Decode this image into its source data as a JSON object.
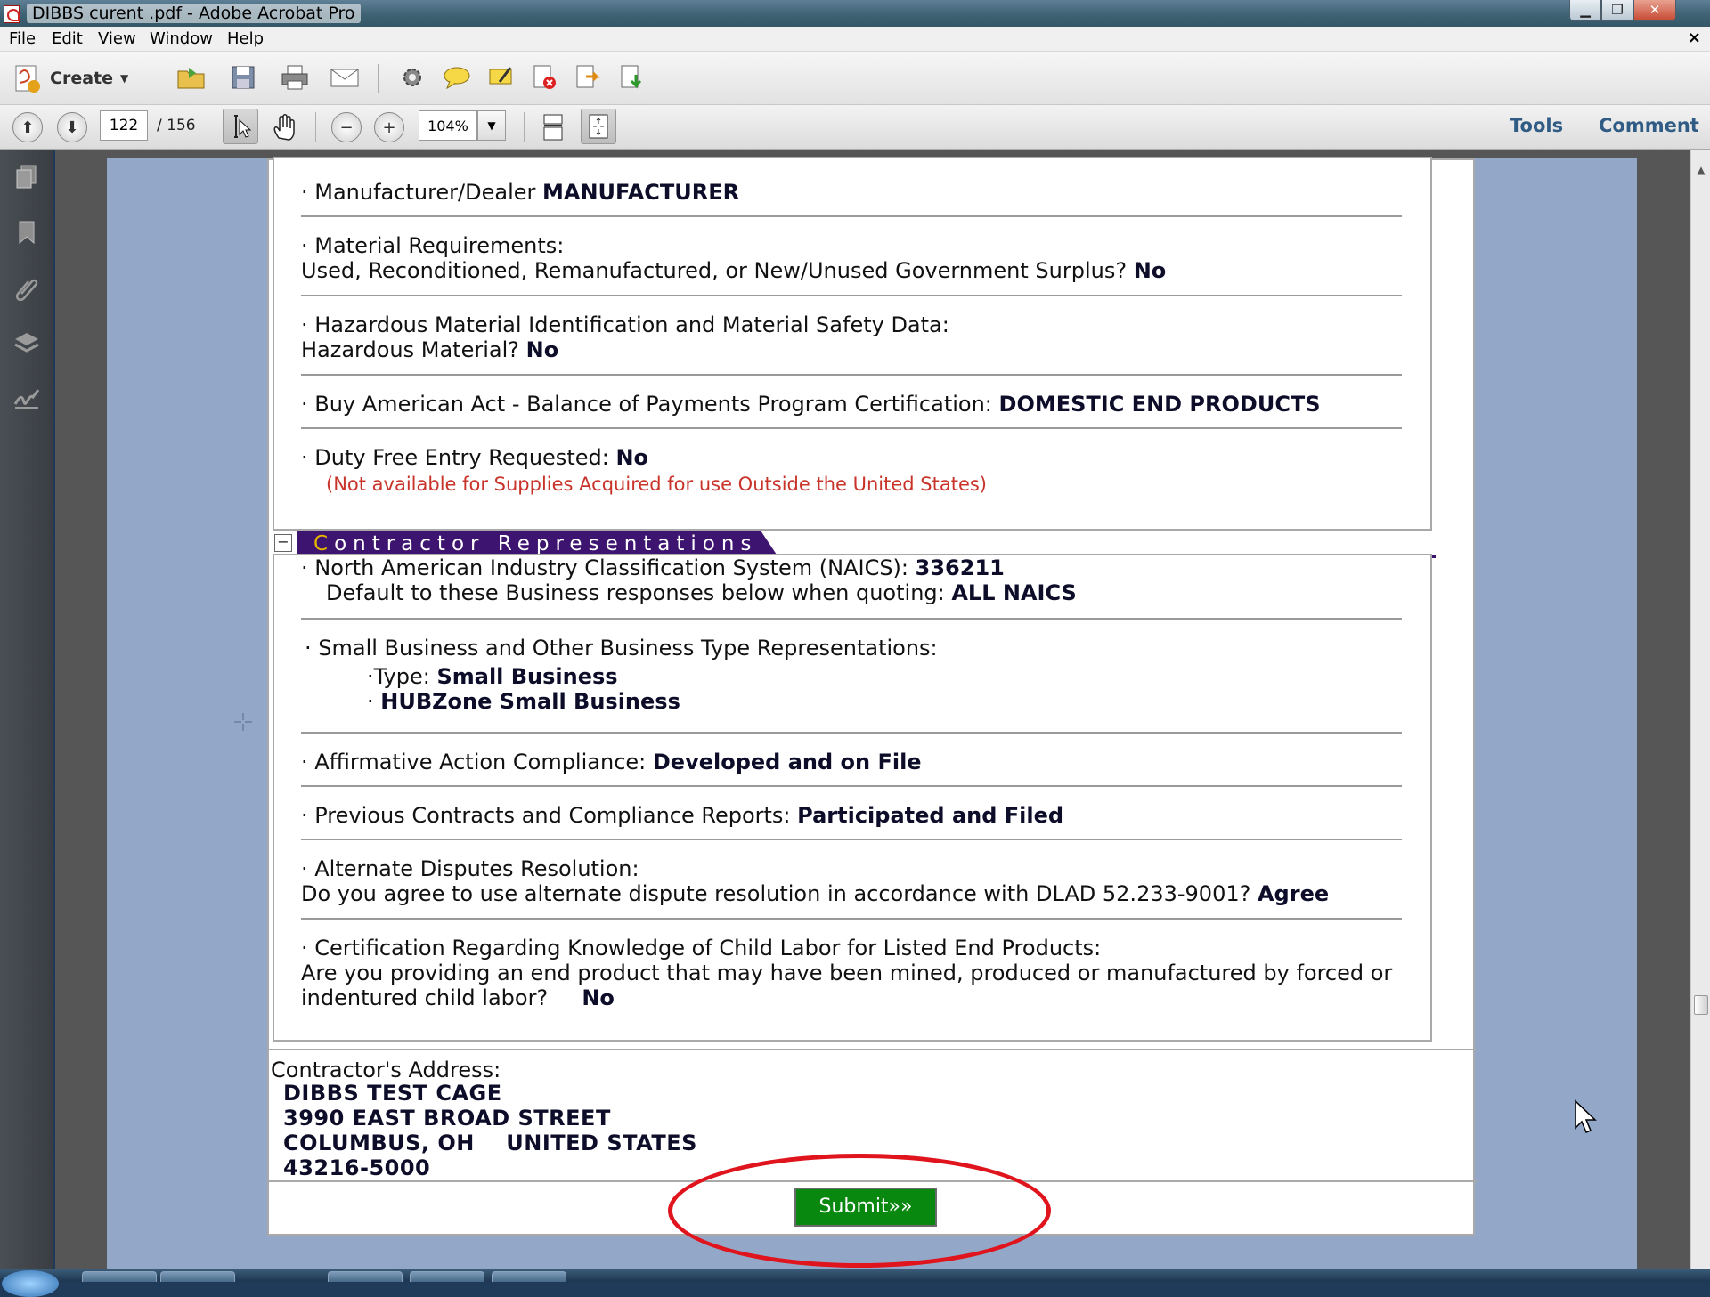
{
  "window": {
    "title": "DIBBS curent .pdf - Adobe Acrobat Pro"
  },
  "menu": [
    "File",
    "Edit",
    "View",
    "Window",
    "Help"
  ],
  "toolbar": {
    "create_label": "Create",
    "page_current": "122",
    "page_total": "/ 156",
    "zoom": "104%",
    "tools_label": "Tools",
    "comment_label": "Comment"
  },
  "left_nav_icons": [
    "pages-icon",
    "bookmarks-icon",
    "attachments-icon",
    "layers-icon",
    "signatures-icon"
  ],
  "document": {
    "manufacturer_label": "· Manufacturer/Dealer ",
    "manufacturer_value": "MANUFACTURER",
    "material_label": "· Material Requirements:",
    "material_question": "Used, Reconditioned, Remanufactured, or New/Unused Government Surplus? ",
    "material_value": "No",
    "hazmat_label": "· Hazardous Material Identification and Material Safety Data:",
    "hazmat_question": "Hazardous Material? ",
    "hazmat_value": "No",
    "buy_american_label": "· Buy American Act - Balance of Payments Program Certification: ",
    "buy_american_value": "DOMESTIC END PRODUCTS",
    "duty_label": "· Duty Free Entry Requested:  ",
    "duty_value": "No",
    "duty_note": "(Not available for Supplies Acquired for use Outside the United States)",
    "section_title_first": "C",
    "section_title_rest": "ontractor Representations",
    "naics_label": "· North American Industry Classification System (NAICS): ",
    "naics_value": "336211",
    "naics_default_label": "Default to these Business responses below when quoting: ",
    "naics_default_value": "ALL NAICS",
    "small_business_label": "· Small Business and Other Business Type Representations:",
    "type_label": "·Type: ",
    "type_value": "Small Business",
    "hubzone_bullet": "· ",
    "hubzone_value": "HUBZone Small Business",
    "affirmative_label": "· Affirmative Action Compliance:  ",
    "affirmative_value": "Developed and on File",
    "previous_label": "· Previous Contracts and Compliance Reports:  ",
    "previous_value": "Participated and Filed",
    "adr_label": "· Alternate Disputes Resolution:",
    "adr_question": "Do you agree to use alternate dispute resolution in accordance with DLAD 52.233-9001? ",
    "adr_value": "Agree",
    "child_labor_label": "· Certification Regarding Knowledge of Child Labor for Listed End Products:",
    "child_labor_question_1": "Are you providing an end product that may have been mined, produced or manufactured by forced or",
    "child_labor_question_2": "indentured child labor?     ",
    "child_labor_value": "No",
    "address_label": "Contractor's Address:",
    "address_lines": [
      "DIBBS TEST CAGE",
      "3990 EAST BROAD STREET",
      "COLUMBUS, OH    UNITED STATES",
      "43216-5000"
    ],
    "submit_label": "Submit»»"
  },
  "colors": {
    "section_bar": "#3d1570",
    "submit": "#08880e",
    "highlight": "#e0141c",
    "link": "#2f5b84"
  }
}
